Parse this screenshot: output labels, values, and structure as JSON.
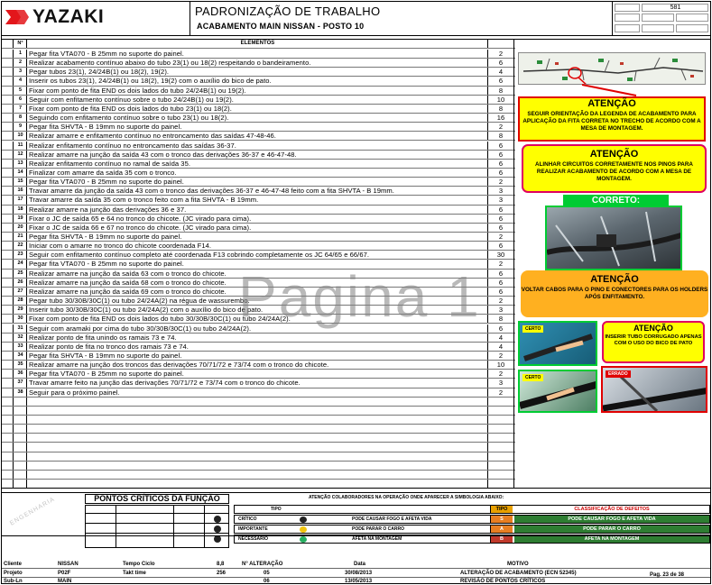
{
  "header": {
    "brand": "YAZAKI",
    "title": "PADRONIZAÇÃO DE TRABALHO",
    "subtitle": "ACABAMENTO MAIN NISSAN -  POSTO 10",
    "doc_number": "581"
  },
  "table": {
    "col_number": "N°",
    "col_elements": "ELEMENTOS",
    "rows": [
      {
        "n": "1",
        "text": "Pegar fita VTA070 - B 25mm no suporte do painel.",
        "t": "2"
      },
      {
        "n": "2",
        "text": "Realizar acabamento contínuo abaixo do tubo 23(1) ou 18(2) respeitando o bandeiramento.",
        "t": "6"
      },
      {
        "n": "3",
        "text": "Pegar tubos 23(1), 24/24B(1) ou 18(2), 19(2).",
        "t": "4"
      },
      {
        "n": "4",
        "text": "Inserir os tubos 23(1), 24/24B(1) ou 18(2), 19(2) com o auxílio do bico de pato.",
        "t": "6"
      },
      {
        "n": "5",
        "text": "Fixar com ponto de fita END os dois lados do tubo 24/24B(1) ou 19(2).",
        "t": "8"
      },
      {
        "n": "6",
        "text": "Seguir com enfitamento contínuo sobre o tubo 24/24B(1) ou 19(2).",
        "t": "10"
      },
      {
        "n": "7",
        "text": "Fixar com ponto de fita END os dois lados do tubo 23(1) ou 18(2).",
        "t": "8"
      },
      {
        "n": "8",
        "text": "Seguindo com enfitamento contínuo sobre o tubo 23(1) ou 18(2).",
        "t": "16"
      },
      {
        "n": "9",
        "text": "Pegar fita SHVTA - B 19mm no suporte do painel.",
        "t": "2"
      },
      {
        "n": "10",
        "text": "Realizar amarre e enfitamento contínuo no entroncamento das saídas 47-48-46.",
        "t": "8"
      },
      {
        "n": "11",
        "text": "Realizar enfitamento contínuo no entroncamento das saídas 36-37.",
        "t": "6"
      },
      {
        "n": "12",
        "text": "Realizar amarre na junção da saída 43 com o tronco das derivações 36-37 e 46-47-48.",
        "t": "6"
      },
      {
        "n": "13",
        "text": "Realizar enfitamento contínuo no ramal de saída 35.",
        "t": "6"
      },
      {
        "n": "14",
        "text": "Finalizar com amarre da saída 35 com o tronco.",
        "t": "6"
      },
      {
        "n": "15",
        "text": "Pegar fita VTA070 - B 25mm no suporte do painel.",
        "t": "2"
      },
      {
        "n": "16",
        "text": "Travar amarre da junção da saída 43 com o tronco das derivações 36-37 e 46-47-48 feito com a fita SHVTA - B 19mm.",
        "t": "3"
      },
      {
        "n": "17",
        "text": "Travar amarre da saída 35 com o tronco feito com a fita SHVTA - B 19mm.",
        "t": "3"
      },
      {
        "n": "18",
        "text": "Realizar amarre na junção das derivações 36 e 37.",
        "t": "6"
      },
      {
        "n": "19",
        "text": "Fixar o JC de saída 65 e 64 no tronco do chicote. (JC virado para cima).",
        "t": "6"
      },
      {
        "n": "20",
        "text": "Fixar o JC de saída 66 e 67 no tronco do chicote. (JC virado para cima).",
        "t": "6"
      },
      {
        "n": "21",
        "text": "Pegar fita SHVTA - B 19mm no suporte do painel.",
        "t": "2"
      },
      {
        "n": "22",
        "text": "Iniciar com o amarre no tronco do chicote coordenada F14.",
        "t": "6"
      },
      {
        "n": "23",
        "text": "Seguir com enfitamento contínuo completo até coordenada F13 cobrindo completamente os JC 64/65 e 66/67.",
        "t": "30"
      },
      {
        "n": "24",
        "text": "Pegar fita VTA070 - B 25mm no suporte do painel.",
        "t": "2"
      },
      {
        "n": "25",
        "text": "Realizar amarre na junção da saída 63 com o tronco do chicote.",
        "t": "6"
      },
      {
        "n": "26",
        "text": "Realizar amarre na junção da saída 68 com o tronco do chicote.",
        "t": "6"
      },
      {
        "n": "27",
        "text": "Realizar amarre na junção da saída 69 com o tronco do chicote.",
        "t": "6"
      },
      {
        "n": "28",
        "text": "Pegar tubo 30/30B/30C(1) ou tubo 24/24A(2) na régua de wassurembo.",
        "t": "2"
      },
      {
        "n": "29",
        "text": "Inserir tubo 30/30B/30C(1) ou tubo 24/24A(2) com o auxílio do bico de pato.",
        "t": "3"
      },
      {
        "n": "30",
        "text": "Fixar com ponto de fita END os dois lados do tubo 30/30B/30C(1) ou tubo 24/24A(2).",
        "t": "8"
      },
      {
        "n": "31",
        "text": "Seguir com aramaki por cima do  tubo 30/30B/30C(1) ou tubo 24/24A(2).",
        "t": "6"
      },
      {
        "n": "32",
        "text": "Realizar ponto de fita unindo os ramais 73 e 74.",
        "t": "4"
      },
      {
        "n": "33",
        "text": "Realizar ponto de fita no tronco dos ramais 73 e 74.",
        "t": "4"
      },
      {
        "n": "34",
        "text": "Pegar fita SHVTA - B 19mm no suporte do painel.",
        "t": "2"
      },
      {
        "n": "35",
        "text": "Realizar amarre na junção dos troncos das derivações 70/71/72 e 73/74 com o tronco do chicote.",
        "t": "10"
      },
      {
        "n": "36",
        "text": "Pegar fita VTA070 - B 25mm no suporte do painel.",
        "t": "2"
      },
      {
        "n": "37",
        "text": "Travar amarre feito na junção das derivações 70/71/72 e 73/74 com o tronco do chicote.",
        "t": "3"
      },
      {
        "n": "38",
        "text": "Seguir para o próximo painel.",
        "t": "2"
      }
    ]
  },
  "watermark": "Pagina 1",
  "right_panel": {
    "attention1": {
      "title": "ATENÇÃO",
      "body": "SEGUIR ORIENTAÇÃO DA LEGENDA DE ACABAMENTO PARA APLICAÇÃO DA FITA CORRETA NO TRECHO DE ACORDO COM A MESA DE MONTAGEM."
    },
    "attention2": {
      "title": "ATENÇÃO",
      "body": "ALINHAR CIRCUITOS CORRETAMENTE NOS PINOS PARA REALIZAR ACABAMENTO DE ACORDO COM A MESA DE MONTAGEM."
    },
    "correct_label": "CORRETO:",
    "attention3": {
      "title": "ATENÇÃO",
      "body": "VOLTAR CABOS PARA O PINO E CONECTORES PARA OS HOLDERS APÓS ENFITAMENTO."
    },
    "attention4": {
      "title": "ATENÇÃO",
      "body": "INSERIR TUBO CORRUGADO APENAS COM O USO DO BICO DE PATO"
    },
    "tag_certo": "CERTO",
    "tag_errado": "ERRADO"
  },
  "bottom": {
    "stamp": "ENGENHARIA",
    "critical_points_title": "PONTOS CRÍTICOS DA FUNÇÃO",
    "attention_note": "ATENÇÃO COLABORADORES NA OPERAÇÃO ONDE APARECER A SIMBOLOGIA ABAIXO:",
    "type_header": "TIPO",
    "defect_class_header": "CLASSIFICAÇÃO DE DEFEITOS",
    "legend": [
      {
        "label": "CRÍTICO",
        "text": "PODE CAUSAR FOGO E AFETA VIDA"
      },
      {
        "label": "IMPORTANTE",
        "text": "PODE PARAR O CARRO"
      },
      {
        "label": "NECESSÁRIO",
        "text": "AFETA NA MONTAGEM"
      }
    ],
    "classes": [
      {
        "n": "S",
        "text": "PODE CAUSAR FOGO E AFETA VIDA",
        "color": "#2e7d32"
      },
      {
        "n": "A",
        "text": "PODE PARAR O CARRO",
        "color": "#2e7d32"
      },
      {
        "n": "B",
        "text": "AFETA NA MONTAGEM",
        "color": "#2e7d32"
      }
    ]
  },
  "footer": {
    "row1": {
      "l1": "Cliente",
      "v1": "NISSAN",
      "l2": "Tempo Ciclo",
      "v2": "8,8",
      "l3": "N° ALTERAÇÃO",
      "l4": "Data",
      "l5": "MOTIVO"
    },
    "row2": {
      "l1": "Projeto",
      "v1": "P02F",
      "l2": "Takt time",
      "v2": "256",
      "v3": "05",
      "v4": "30/08/2013",
      "v5": "ALTERAÇÃO DE ACABAMENTO (ECN 52345)",
      "page": "Pag. 23 de 38"
    },
    "row3": {
      "l1": "Sub-Ln",
      "v1": "MAIN",
      "v3": "06",
      "v4": "13/05/2013",
      "v5": "REVISÃO DE PONTOS CRÍTICOS"
    }
  }
}
